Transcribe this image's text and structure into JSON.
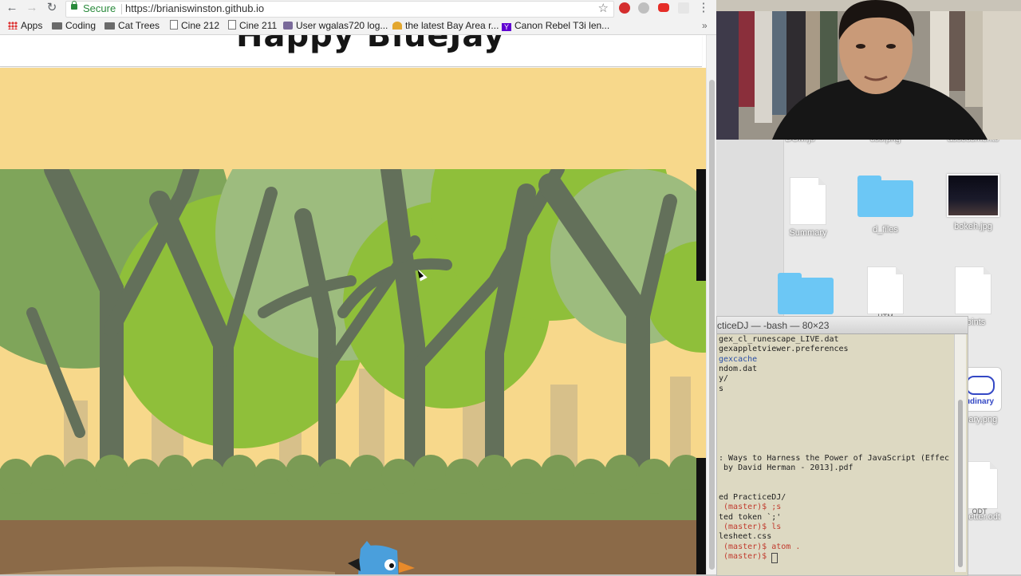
{
  "browser": {
    "secure_label": "Secure",
    "url": "https://brianiswinston.github.io",
    "bookmarks": [
      {
        "label": "Apps",
        "icon": "apps-grid-icon"
      },
      {
        "label": "Coding",
        "icon": "folder-icon"
      },
      {
        "label": "Cat Trees",
        "icon": "folder-icon"
      },
      {
        "label": "Cine 212",
        "icon": "page-icon"
      },
      {
        "label": "Cine 211",
        "icon": "page-icon"
      },
      {
        "label": "User wgalas720 log...",
        "icon": "avatar-icon"
      },
      {
        "label": "the latest Bay Area r...",
        "icon": "shape-icon"
      },
      {
        "label": "Canon Rebel T3i len...",
        "icon": "yahoo-icon"
      }
    ]
  },
  "site": {
    "title": "Happy BlueJay"
  },
  "game": {
    "colors": {
      "sky": "#f7d88b",
      "leaves_light": "#9dbc7e",
      "leaves_bright": "#8fbf3a",
      "trunks": "#63705a",
      "bushes": "#7b9b55",
      "ground": "#8b6a48",
      "bird": "#4a9fdc"
    }
  },
  "finder": {
    "files": [
      {
        "label": "DOM.js",
        "kind": "document"
      },
      {
        "label": "css.png",
        "kind": "document"
      },
      {
        "label": "assessments",
        "kind": "folder"
      },
      {
        "label": "Summary",
        "kind": "document"
      },
      {
        "label": "d_files",
        "kind": "folder"
      },
      {
        "label": "bokeh.jpg",
        "kind": "image"
      },
      {
        "label": "",
        "kind": "folder"
      },
      {
        "label": "HTM",
        "kind": "document"
      },
      {
        "label": "Points",
        "kind": "document"
      },
      {
        "label": "udinary",
        "kind": "app"
      },
      {
        "label": "inary.png",
        "kind": "image"
      },
      {
        "label": "ODT",
        "kind": "document"
      },
      {
        "label": "_Letter.odt",
        "kind": "document"
      }
    ]
  },
  "terminal": {
    "title": "cticeDJ — -bash — 80×23",
    "lines": [
      {
        "text": "gex_cl_runescape_LIVE.dat",
        "style": "plain"
      },
      {
        "text": "gexappletviewer.preferences",
        "style": "plain"
      },
      {
        "text": "gexcache",
        "style": "dir"
      },
      {
        "text": "ndom.dat",
        "style": "plain"
      },
      {
        "text": "y/",
        "style": "plain"
      },
      {
        "text": "s",
        "style": "plain"
      },
      {
        "text": ": Ways to Harness the Power of JavaScript (Effec",
        "style": "plain"
      },
      {
        "text": " by David Herman - 2013].pdf",
        "style": "plain"
      },
      {
        "text": "ed PracticeDJ/",
        "style": "plain"
      },
      {
        "text": " (master)$ ;s",
        "style": "prompt"
      },
      {
        "text": "ted token `;'",
        "style": "plain"
      },
      {
        "text": " (master)$ ls",
        "style": "prompt"
      },
      {
        "text": "lesheet.css",
        "style": "plain"
      },
      {
        "text": " (master)$ atom .",
        "style": "prompt"
      },
      {
        "text": " (master)$ ",
        "style": "prompt"
      }
    ]
  }
}
